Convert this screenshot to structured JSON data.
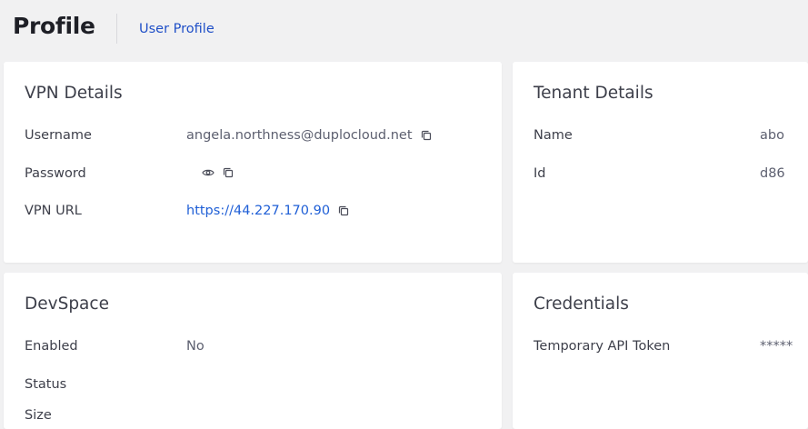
{
  "header": {
    "title": "Profile",
    "breadcrumb": "User Profile"
  },
  "vpn": {
    "title": "VPN Details",
    "rows": [
      {
        "label": "Username",
        "value": "angela.northness@duplocloud.net"
      },
      {
        "label": "Password",
        "value": ""
      },
      {
        "label": "VPN URL",
        "value": "https://44.227.170.90"
      }
    ]
  },
  "tenant": {
    "title": "Tenant Details",
    "rows": [
      {
        "label": "Name",
        "value": "abo"
      },
      {
        "label": "Id",
        "value": "d86"
      }
    ]
  },
  "devspace": {
    "title": "DevSpace",
    "rows": [
      {
        "label": "Enabled",
        "value": "No"
      },
      {
        "label": "Status",
        "value": ""
      },
      {
        "label": "Size",
        "value": ""
      }
    ]
  },
  "credentials": {
    "title": "Credentials",
    "rows": [
      {
        "label": "Temporary API Token",
        "value": "*****"
      }
    ]
  },
  "colors": {
    "link": "#1f5fd6",
    "breadcrumb": "#1f4fc7",
    "background": "#f1f1f2"
  },
  "icons": {
    "copy": "copy-icon",
    "reveal": "eye-icon"
  }
}
